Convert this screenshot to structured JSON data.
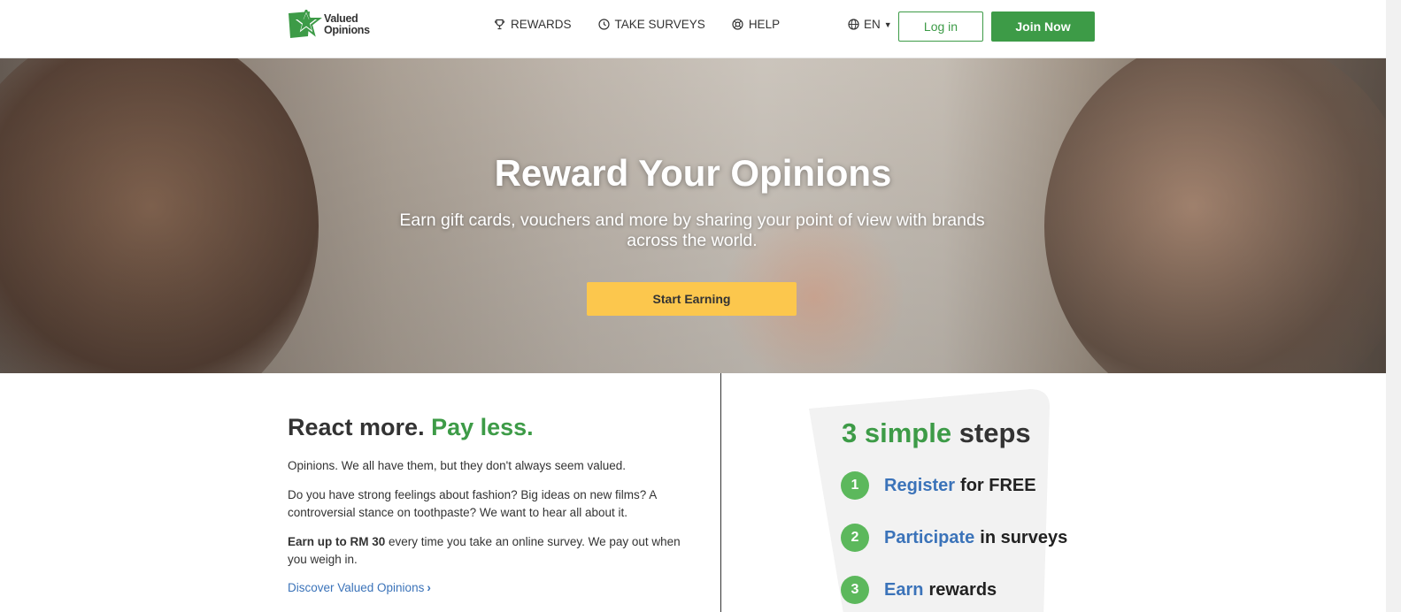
{
  "header": {
    "logo_line1": "Valued",
    "logo_line2": "Opinions",
    "nav": [
      {
        "label": "REWARDS",
        "icon": "trophy-icon"
      },
      {
        "label": "TAKE SURVEYS",
        "icon": "clock-icon"
      },
      {
        "label": "HELP",
        "icon": "lifebuoy-icon"
      }
    ],
    "language": "EN",
    "login_label": "Log in",
    "join_label": "Join Now"
  },
  "hero": {
    "title": "Reward Your Opinions",
    "subtitle": "Earn gift cards, vouchers and more by sharing your point of view with brands across the world.",
    "cta_label": "Start Earning"
  },
  "intro": {
    "heading_part1": "React more.",
    "heading_part2": "Pay less.",
    "p1": "Opinions. We all have them, but they don't always seem valued.",
    "p2": "Do you have strong feelings about fashion? Big ideas on new films? A controversial stance on toothpaste? We want to hear all about it.",
    "p3_bold": "Earn up to RM 30",
    "p3_rest": " every time you take an online survey. We pay out when you weigh in.",
    "discover_label": "Discover Valued Opinions"
  },
  "steps": {
    "title_green": "3 simple",
    "title_rest": "steps",
    "items": [
      {
        "num": "1",
        "action": "Register",
        "rest": "for FREE"
      },
      {
        "num": "2",
        "action": "Participate",
        "rest": "in surveys"
      },
      {
        "num": "3",
        "action": "Earn",
        "rest": "rewards"
      }
    ]
  },
  "colors": {
    "brand_green": "#3d9b47",
    "cta_yellow": "#fcc74d",
    "link_blue": "#3b73b9",
    "step_circle": "#5cb85c"
  }
}
